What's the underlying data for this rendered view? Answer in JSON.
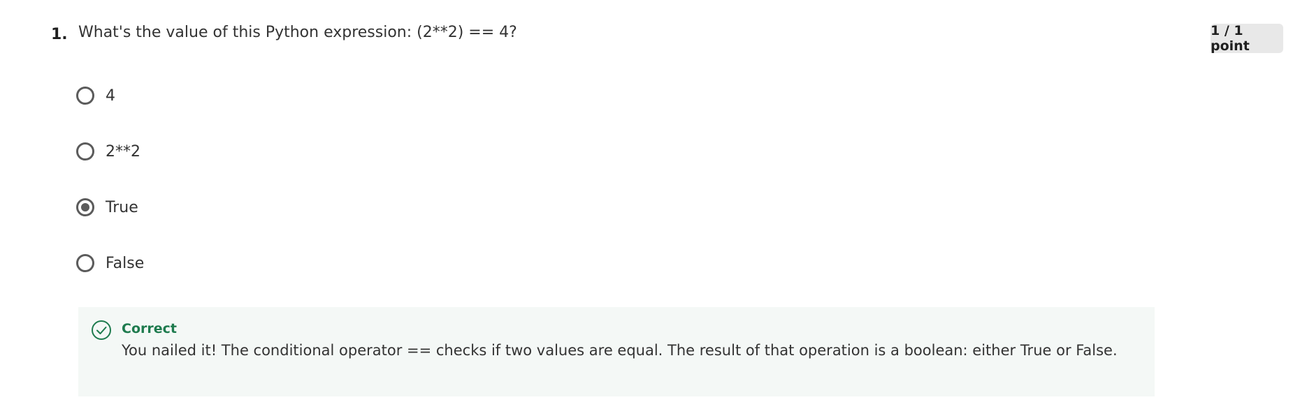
{
  "question": {
    "number": "1.",
    "text": "What's the value of this Python expression: (2**2) == 4?",
    "points": "1 / 1 point"
  },
  "options": [
    {
      "label": "4",
      "selected": false
    },
    {
      "label": "2**2",
      "selected": false
    },
    {
      "label": "True",
      "selected": true
    },
    {
      "label": "False",
      "selected": false
    }
  ],
  "feedback": {
    "icon": "check-circle-icon",
    "status": "Correct",
    "text": "You nailed it! The conditional operator == checks if two values are equal. The result of that operation is a boolean: either True or False."
  },
  "colors": {
    "correct_green": "#1e7b4e",
    "feedback_bg": "#f4f8f6",
    "badge_bg": "#e8e8e8",
    "radio_gray": "#5b5b5b"
  }
}
